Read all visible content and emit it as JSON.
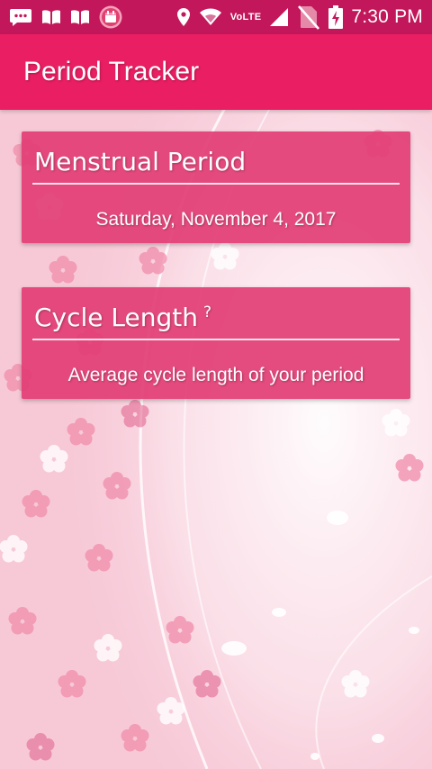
{
  "status_bar": {
    "left_icons": [
      "message-icon",
      "book-icon",
      "book-icon",
      "calendar-app-icon"
    ],
    "right_icons": [
      "location-icon",
      "wifi-icon",
      "signal-icon",
      "no-sim-icon",
      "battery-charging-icon"
    ],
    "network_label": "VoLTE",
    "time": "7:30 PM"
  },
  "app_bar": {
    "title": "Period Tracker"
  },
  "cards": [
    {
      "title": "Menstrual Period",
      "value": "Saturday, November 4, 2017"
    },
    {
      "title": "Cycle Length",
      "help_mark": "?",
      "value": "Average cycle length of your period"
    }
  ],
  "colors": {
    "status_bar": "#c2185b",
    "app_bar": "#e91e63",
    "card": "#e23e75",
    "background": "#fbe3ea"
  }
}
